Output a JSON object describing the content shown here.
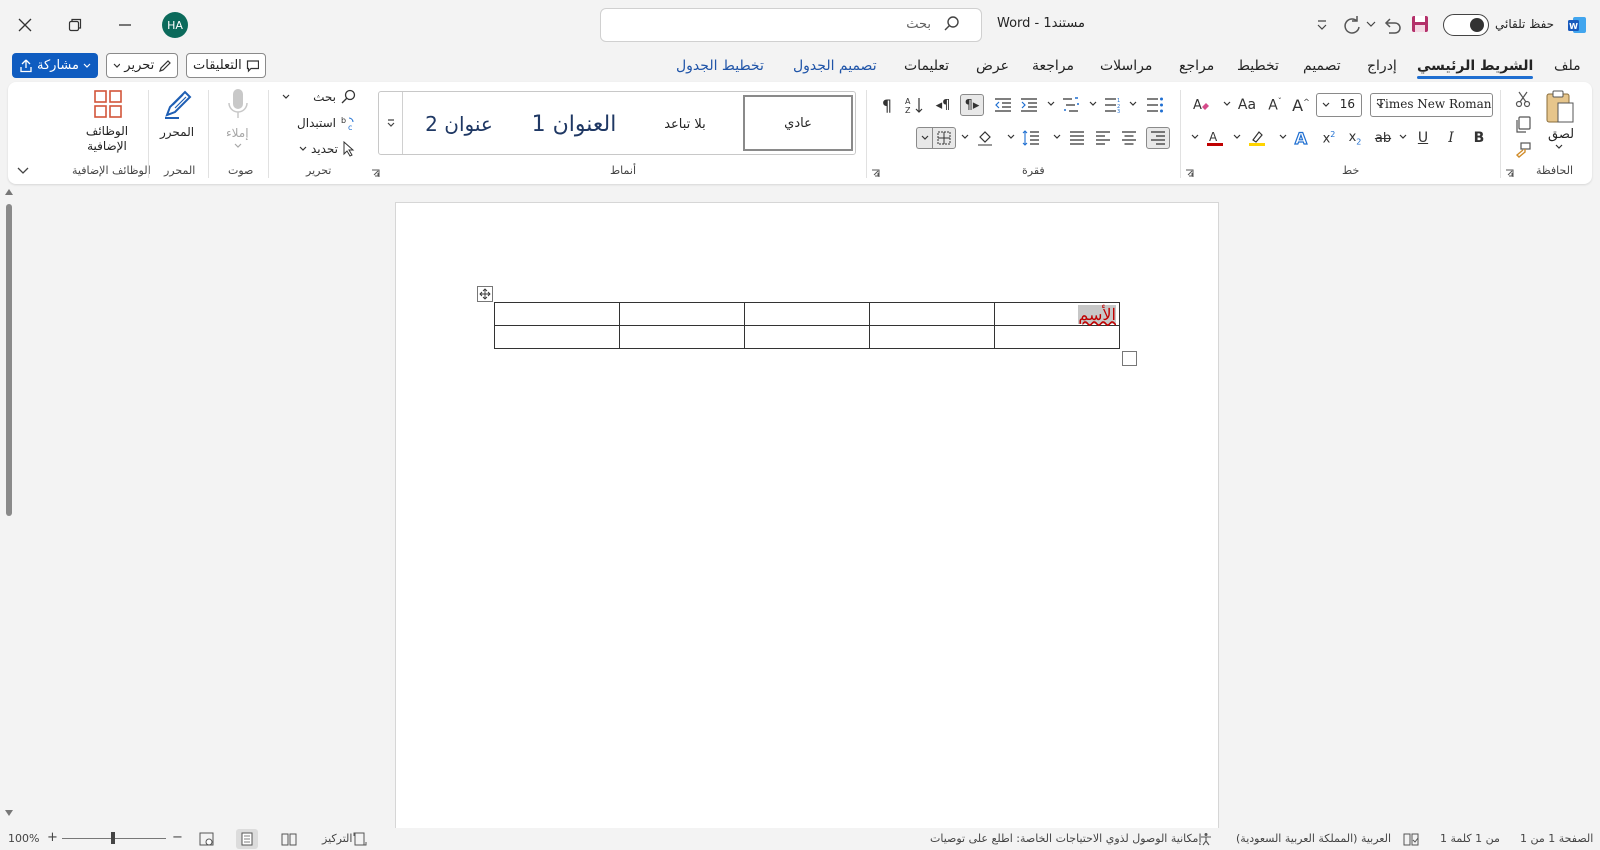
{
  "titlebar": {
    "doc_title": "مستند1 - Word",
    "autosave_label": "حفظ تلقائي",
    "search_placeholder": "بحث",
    "avatar_initials": "HA"
  },
  "tabs": {
    "file": "ملف",
    "home": "الشريط الرئيسي",
    "insert": "إدراج",
    "design": "تصميم",
    "layout": "تخطيط",
    "references": "مراجع",
    "mailings": "مراسلات",
    "review": "مراجعة",
    "view": "عرض",
    "help": "تعليمات",
    "table_design": "تصميم الجدول",
    "table_layout": "تخطيط الجدول",
    "comments": "التعليقات",
    "editing_mode": "تحرير",
    "share": "مشاركة"
  },
  "ribbon": {
    "clipboard": {
      "label": "الحافظة",
      "paste": "لصق"
    },
    "font": {
      "label": "خط",
      "name": "Times New Roman (",
      "size": "16"
    },
    "paragraph": {
      "label": "فقرة"
    },
    "styles": {
      "label": "أنماط",
      "items": [
        "عادي",
        "بلا تباعد",
        "العنوان 1",
        "عنوان 2"
      ]
    },
    "editing": {
      "label": "تحرير",
      "find": "بحث",
      "replace": "استبدال",
      "select": "تحديد"
    },
    "voice": {
      "label": "صوت",
      "dictate": "إملاء"
    },
    "editor": {
      "label": "المحرر",
      "button": "المحرر"
    },
    "addins": {
      "label": "الوظائف الإضافية",
      "button": "الوظائف الإضافية"
    }
  },
  "document": {
    "table_cell_text": "الأسم"
  },
  "statusbar": {
    "page": "الصفحة 1 من 1",
    "words": "1 من 1 كلمة",
    "language": "العربية (المملكة العربية السعودية)",
    "accessibility": "إمكانية الوصول لذوي الاحتياجات الخاصة: اطلع على توصيات",
    "focus": "التركيز",
    "zoom": "100%"
  },
  "colors": {
    "accent": "#0f5cc0",
    "word_blue": "#185abd",
    "font_color_red": "#c00000",
    "highlight_yellow": "#ffd400"
  }
}
